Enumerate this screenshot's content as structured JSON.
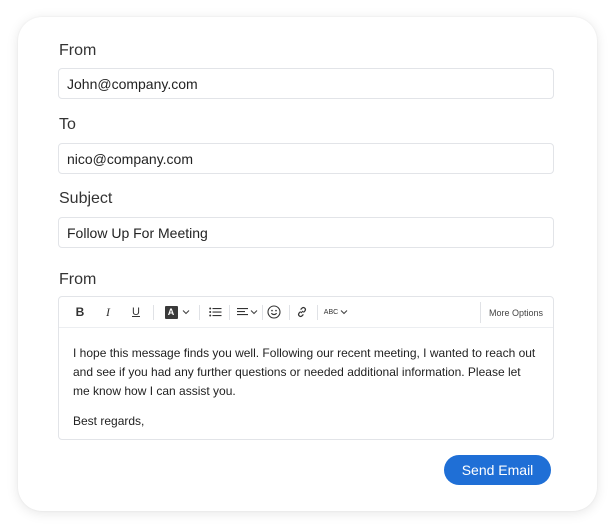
{
  "form": {
    "from_label": "From",
    "from_value": "John@company.com",
    "to_label": "To",
    "to_value": "nico@company.com",
    "subject_label": "Subject",
    "subject_value": "Follow Up For Meeting",
    "message_label": "From"
  },
  "toolbar": {
    "bold": "B",
    "italic": "I",
    "underline": "U",
    "text_color": "A",
    "spellcheck": "ABC",
    "more_options": "More Options"
  },
  "message": {
    "paragraph": "I hope this message finds you well. Following our recent meeting, I wanted to reach out and see if you had any further questions or needed additional information. Please let me know how I can assist you.",
    "closing": "Best regards,"
  },
  "actions": {
    "send_label": "Send Email"
  },
  "colors": {
    "accent": "#1f6fd6"
  },
  "icons": [
    "bold-icon",
    "italic-icon",
    "underline-icon",
    "text-color-icon",
    "chevron-down-icon",
    "bulleted-list-icon",
    "align-icon",
    "emoji-icon",
    "link-icon",
    "spellcheck-icon"
  ]
}
